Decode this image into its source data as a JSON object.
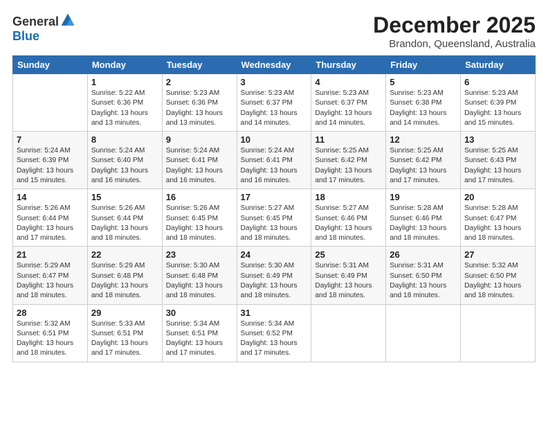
{
  "logo": {
    "general": "General",
    "blue": "Blue"
  },
  "header": {
    "title": "December 2025",
    "subtitle": "Brandon, Queensland, Australia"
  },
  "weekdays": [
    "Sunday",
    "Monday",
    "Tuesday",
    "Wednesday",
    "Thursday",
    "Friday",
    "Saturday"
  ],
  "weeks": [
    [
      {
        "day": "",
        "info": ""
      },
      {
        "day": "1",
        "info": "Sunrise: 5:22 AM\nSunset: 6:36 PM\nDaylight: 13 hours\nand 13 minutes."
      },
      {
        "day": "2",
        "info": "Sunrise: 5:23 AM\nSunset: 6:36 PM\nDaylight: 13 hours\nand 13 minutes."
      },
      {
        "day": "3",
        "info": "Sunrise: 5:23 AM\nSunset: 6:37 PM\nDaylight: 13 hours\nand 14 minutes."
      },
      {
        "day": "4",
        "info": "Sunrise: 5:23 AM\nSunset: 6:37 PM\nDaylight: 13 hours\nand 14 minutes."
      },
      {
        "day": "5",
        "info": "Sunrise: 5:23 AM\nSunset: 6:38 PM\nDaylight: 13 hours\nand 14 minutes."
      },
      {
        "day": "6",
        "info": "Sunrise: 5:23 AM\nSunset: 6:39 PM\nDaylight: 13 hours\nand 15 minutes."
      }
    ],
    [
      {
        "day": "7",
        "info": "Sunrise: 5:24 AM\nSunset: 6:39 PM\nDaylight: 13 hours\nand 15 minutes."
      },
      {
        "day": "8",
        "info": "Sunrise: 5:24 AM\nSunset: 6:40 PM\nDaylight: 13 hours\nand 16 minutes."
      },
      {
        "day": "9",
        "info": "Sunrise: 5:24 AM\nSunset: 6:41 PM\nDaylight: 13 hours\nand 16 minutes."
      },
      {
        "day": "10",
        "info": "Sunrise: 5:24 AM\nSunset: 6:41 PM\nDaylight: 13 hours\nand 16 minutes."
      },
      {
        "day": "11",
        "info": "Sunrise: 5:25 AM\nSunset: 6:42 PM\nDaylight: 13 hours\nand 17 minutes."
      },
      {
        "day": "12",
        "info": "Sunrise: 5:25 AM\nSunset: 6:42 PM\nDaylight: 13 hours\nand 17 minutes."
      },
      {
        "day": "13",
        "info": "Sunrise: 5:25 AM\nSunset: 6:43 PM\nDaylight: 13 hours\nand 17 minutes."
      }
    ],
    [
      {
        "day": "14",
        "info": "Sunrise: 5:26 AM\nSunset: 6:44 PM\nDaylight: 13 hours\nand 17 minutes."
      },
      {
        "day": "15",
        "info": "Sunrise: 5:26 AM\nSunset: 6:44 PM\nDaylight: 13 hours\nand 18 minutes."
      },
      {
        "day": "16",
        "info": "Sunrise: 5:26 AM\nSunset: 6:45 PM\nDaylight: 13 hours\nand 18 minutes."
      },
      {
        "day": "17",
        "info": "Sunrise: 5:27 AM\nSunset: 6:45 PM\nDaylight: 13 hours\nand 18 minutes."
      },
      {
        "day": "18",
        "info": "Sunrise: 5:27 AM\nSunset: 6:46 PM\nDaylight: 13 hours\nand 18 minutes."
      },
      {
        "day": "19",
        "info": "Sunrise: 5:28 AM\nSunset: 6:46 PM\nDaylight: 13 hours\nand 18 minutes."
      },
      {
        "day": "20",
        "info": "Sunrise: 5:28 AM\nSunset: 6:47 PM\nDaylight: 13 hours\nand 18 minutes."
      }
    ],
    [
      {
        "day": "21",
        "info": "Sunrise: 5:29 AM\nSunset: 6:47 PM\nDaylight: 13 hours\nand 18 minutes."
      },
      {
        "day": "22",
        "info": "Sunrise: 5:29 AM\nSunset: 6:48 PM\nDaylight: 13 hours\nand 18 minutes."
      },
      {
        "day": "23",
        "info": "Sunrise: 5:30 AM\nSunset: 6:48 PM\nDaylight: 13 hours\nand 18 minutes."
      },
      {
        "day": "24",
        "info": "Sunrise: 5:30 AM\nSunset: 6:49 PM\nDaylight: 13 hours\nand 18 minutes."
      },
      {
        "day": "25",
        "info": "Sunrise: 5:31 AM\nSunset: 6:49 PM\nDaylight: 13 hours\nand 18 minutes."
      },
      {
        "day": "26",
        "info": "Sunrise: 5:31 AM\nSunset: 6:50 PM\nDaylight: 13 hours\nand 18 minutes."
      },
      {
        "day": "27",
        "info": "Sunrise: 5:32 AM\nSunset: 6:50 PM\nDaylight: 13 hours\nand 18 minutes."
      }
    ],
    [
      {
        "day": "28",
        "info": "Sunrise: 5:32 AM\nSunset: 6:51 PM\nDaylight: 13 hours\nand 18 minutes."
      },
      {
        "day": "29",
        "info": "Sunrise: 5:33 AM\nSunset: 6:51 PM\nDaylight: 13 hours\nand 17 minutes."
      },
      {
        "day": "30",
        "info": "Sunrise: 5:34 AM\nSunset: 6:51 PM\nDaylight: 13 hours\nand 17 minutes."
      },
      {
        "day": "31",
        "info": "Sunrise: 5:34 AM\nSunset: 6:52 PM\nDaylight: 13 hours\nand 17 minutes."
      },
      {
        "day": "",
        "info": ""
      },
      {
        "day": "",
        "info": ""
      },
      {
        "day": "",
        "info": ""
      }
    ]
  ]
}
